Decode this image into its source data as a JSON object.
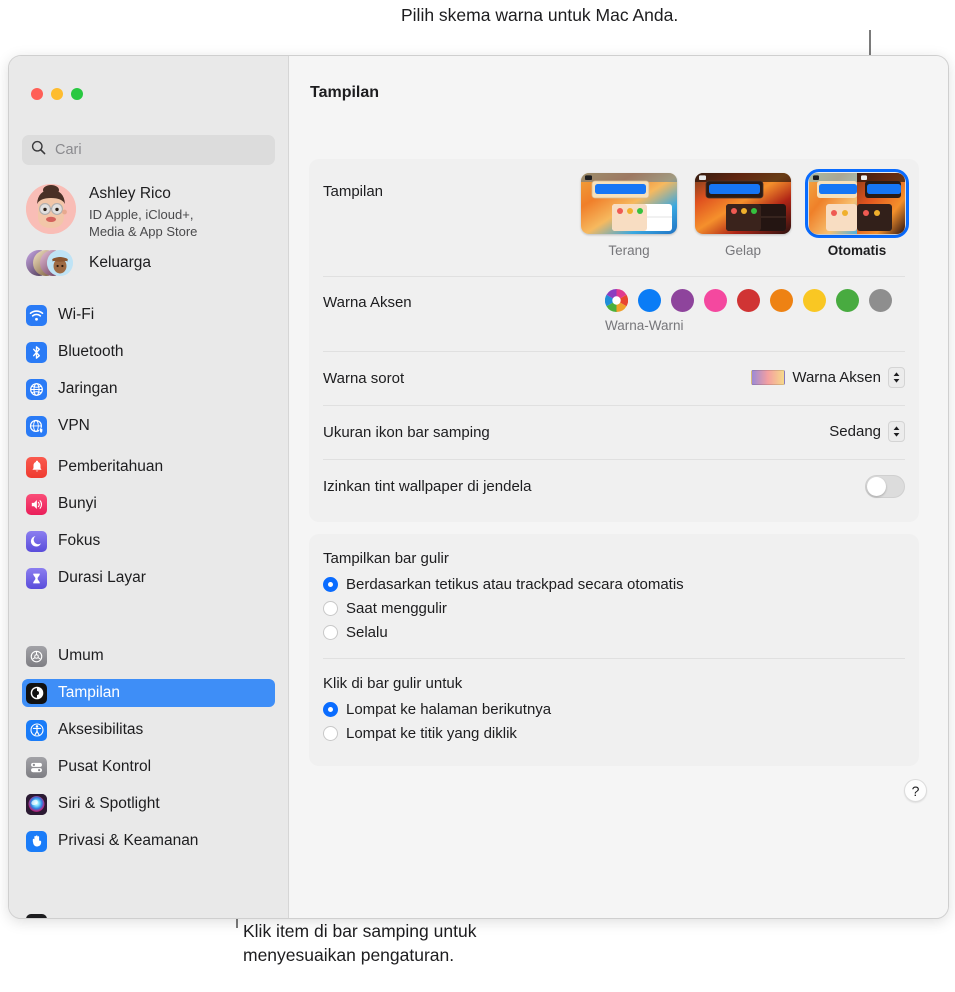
{
  "callouts": {
    "top": "Pilih skema warna untuk Mac Anda.",
    "bottom": "Klik item di bar samping untuk\nmenyesuaikan pengaturan."
  },
  "window": {
    "traffic_lights": [
      "close",
      "minimize",
      "maximize"
    ]
  },
  "sidebar": {
    "search": {
      "placeholder": "Cari",
      "value": "",
      "icon": "search-icon"
    },
    "account": {
      "name": "Ashley Rico",
      "subtitle": "ID Apple, iCloud+,\nMedia & App Store",
      "avatar": "memoji-avatar"
    },
    "family": {
      "label": "Keluarga",
      "icon": "family-avatars-icon"
    },
    "groups": [
      {
        "items": [
          {
            "label": "Wi-Fi",
            "icon": "wifi-icon",
            "color": "#2a7bf6",
            "selected": false
          },
          {
            "label": "Bluetooth",
            "icon": "bluetooth-icon",
            "color": "#2a7bf6",
            "selected": false
          },
          {
            "label": "Jaringan",
            "icon": "network-globe-icon",
            "color": "#2a7bf6",
            "selected": false
          },
          {
            "label": "VPN",
            "icon": "vpn-globe-icon",
            "color": "#2a7bf6",
            "selected": false
          }
        ]
      },
      {
        "items": [
          {
            "label": "Pemberitahuan",
            "icon": "bell-icon",
            "color": "#f0463c",
            "selected": false
          },
          {
            "label": "Bunyi",
            "icon": "speaker-icon",
            "color": "#f1376a",
            "selected": false
          },
          {
            "label": "Fokus",
            "icon": "moon-icon",
            "color": "#6f6ae0",
            "selected": false
          },
          {
            "label": "Durasi Layar",
            "icon": "hourglass-icon",
            "color": "#6f6ae0",
            "selected": false
          }
        ]
      },
      {
        "items": [
          {
            "label": "Umum",
            "icon": "gear-icon",
            "color": "#8e8e93",
            "selected": false
          },
          {
            "label": "Tampilan",
            "icon": "appearance-icon",
            "color": "#121212",
            "selected": true
          },
          {
            "label": "Aksesibilitas",
            "icon": "accessibility-icon",
            "color": "#1a7cf8",
            "selected": false
          },
          {
            "label": "Pusat Kontrol",
            "icon": "control-center-icon",
            "color": "#8e8e93",
            "selected": false
          },
          {
            "label": "Siri & Spotlight",
            "icon": "siri-icon",
            "color": "#2b1a33",
            "selected": false
          },
          {
            "label": "Privasi & Keamanan",
            "icon": "hand-privacy-icon",
            "color": "#1a7cf8",
            "selected": false
          }
        ]
      }
    ]
  },
  "content": {
    "title": "Tampilan",
    "appearance": {
      "label": "Tampilan",
      "options": [
        {
          "name": "Terang",
          "selected": false
        },
        {
          "name": "Gelap",
          "selected": false
        },
        {
          "name": "Otomatis",
          "selected": true
        }
      ]
    },
    "accent": {
      "label": "Warna Aksen",
      "caption": "Warna-Warni",
      "swatches": [
        {
          "name": "multicolor",
          "color": "multicolor",
          "selected": true
        },
        {
          "name": "blue",
          "color": "#0a7cf6",
          "selected": false
        },
        {
          "name": "purple",
          "color": "#8e449c",
          "selected": false
        },
        {
          "name": "pink",
          "color": "#f4489f",
          "selected": false
        },
        {
          "name": "red",
          "color": "#d03434",
          "selected": false
        },
        {
          "name": "orange",
          "color": "#ee8213",
          "selected": false
        },
        {
          "name": "yellow",
          "color": "#f9c723",
          "selected": false
        },
        {
          "name": "green",
          "color": "#48ab40",
          "selected": false
        },
        {
          "name": "graphite",
          "color": "#8e8e8e",
          "selected": false
        }
      ]
    },
    "highlight": {
      "label": "Warna sorot",
      "value": "Warna Aksen",
      "chip": "accent-gradient-chip"
    },
    "sidebar_icon_size": {
      "label": "Ukuran ikon bar samping",
      "value": "Sedang"
    },
    "wallpaper_tint": {
      "label": "Izinkan tint wallpaper di jendela",
      "enabled": false
    },
    "show_scrollbars": {
      "heading": "Tampilkan bar gulir",
      "options": [
        {
          "label": "Berdasarkan tetikus atau trackpad secara otomatis",
          "selected": true
        },
        {
          "label": "Saat menggulir",
          "selected": false
        },
        {
          "label": "Selalu",
          "selected": false
        }
      ]
    },
    "click_scrollbar": {
      "heading": "Klik di bar gulir untuk",
      "options": [
        {
          "label": "Lompat ke halaman berikutnya",
          "selected": true
        },
        {
          "label": "Lompat ke titik yang diklik",
          "selected": false
        }
      ]
    },
    "help_button": {
      "label": "?"
    }
  },
  "colors": {
    "accent_blue": "#0a6cff",
    "selection_blue": "#3e8ef7",
    "sidebar_bg": "#e9e9e9",
    "card_bg": "#f0f0f0",
    "content_bg": "#f5f5f5"
  }
}
